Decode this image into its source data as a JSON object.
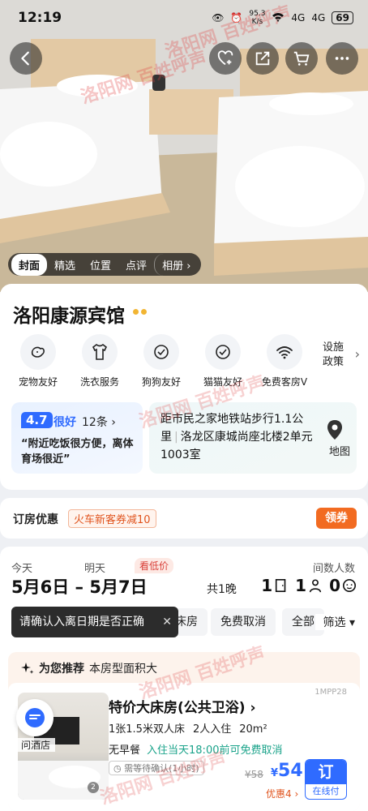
{
  "status_bar": {
    "time": "12:19",
    "net_speed_value": "95.3",
    "net_speed_unit": "K/s",
    "sim1": "4G",
    "sim2": "4G",
    "battery": "69"
  },
  "gallery": {
    "tabs": [
      "封面",
      "精选",
      "位置",
      "点评",
      "相册"
    ],
    "active_tab": "封面",
    "watermark": "洛阳网 百姓呼声"
  },
  "hotel": {
    "name": "洛阳康源宾馆",
    "amenities": [
      {
        "label": "宠物友好",
        "icon": "pet-icon"
      },
      {
        "label": "洗衣服务",
        "icon": "laundry-icon"
      },
      {
        "label": "狗狗友好",
        "icon": "check-circle-icon"
      },
      {
        "label": "猫猫友好",
        "icon": "check-circle-icon"
      },
      {
        "label": "免费客房V",
        "icon": "wifi-icon"
      }
    ],
    "policy_line1": "设施",
    "policy_line2": "政策",
    "review": {
      "score": "4.7",
      "label": "很好",
      "count": "12条",
      "quote": "“附近吃饭很方便，离体育场很近”"
    },
    "location": {
      "distance": "距市民之家地铁站步行1.1公里",
      "address": "洛龙区康城尚座北楼2单元1003室",
      "map_label": "地图"
    }
  },
  "coupon": {
    "title": "订房优惠",
    "tag": "火车新客券减10",
    "button": "领券"
  },
  "dates": {
    "checkin_label": "今天",
    "checkout_label": "明天",
    "cheap_tag": "看低价",
    "checkin": "5月6日",
    "checkout": "5月7日",
    "nights": "共1晚",
    "guests_label": "间数人数",
    "rooms": "1",
    "adults": "1",
    "children": "0"
  },
  "tooltip": "请确认入离日期是否正确",
  "filters": [
    "大床房",
    "免费取消",
    "全部"
  ],
  "filter_button": "筛选",
  "recommend": {
    "title": "为您推荐",
    "subtitle": "本房型面积大"
  },
  "room": {
    "code": "1MPP28",
    "title": "特价大床房(公共卫浴)",
    "bed": "1张1.5米双人床",
    "guests": "2人入住",
    "area": "20m²",
    "breakfast": "无早餐",
    "cancel": "入住当天18:00前可免费取消",
    "confirm": "需等待确认(1小时)",
    "old_price": "¥58",
    "price_symbol": "¥",
    "price": "54",
    "discount": "优惠4",
    "book_label": "订",
    "book_sub": "在线付",
    "photo_count": "2"
  },
  "chat": {
    "label": "问酒店"
  },
  "colors": {
    "accent_blue": "#2f6bff",
    "orange": "#f26b21",
    "green": "#1aa38a"
  }
}
